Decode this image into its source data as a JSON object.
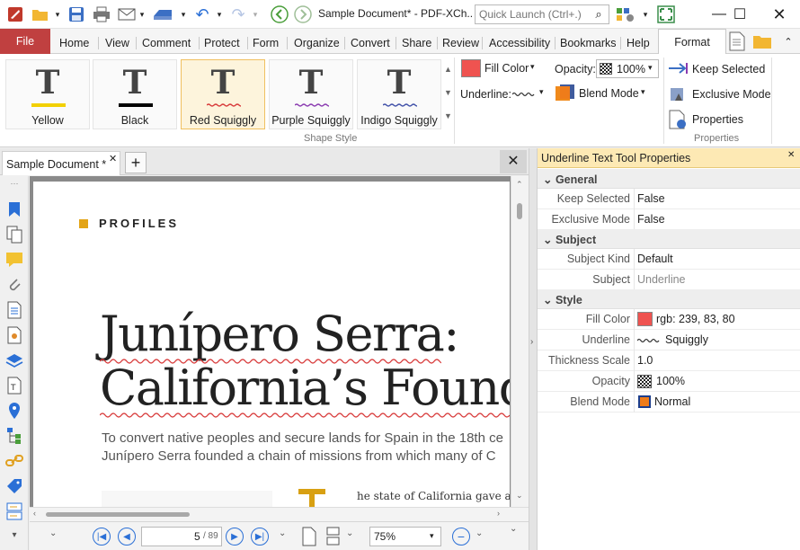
{
  "window": {
    "title": "Sample Document* - PDF-XCh..",
    "quick_launch_placeholder": "Quick Launch (Ctrl+.)"
  },
  "menu_tabs": [
    "File",
    "Home",
    "View",
    "Comment",
    "Protect",
    "Form",
    "Organize",
    "Convert",
    "Share",
    "Review",
    "Accessibility",
    "Bookmarks",
    "Help",
    "Format"
  ],
  "ribbon": {
    "shapes": [
      {
        "label": "Yellow",
        "color": "#f2d000",
        "style": "solid"
      },
      {
        "label": "Black",
        "color": "#000000",
        "style": "solid"
      },
      {
        "label": "Red Squiggly",
        "color": "#d83a3a",
        "style": "squiggly"
      },
      {
        "label": "Purple Squiggly",
        "color": "#8a3ab0",
        "style": "squiggly"
      },
      {
        "label": "Indigo Squiggly",
        "color": "#4050a8",
        "style": "squiggly"
      }
    ],
    "shape_style_label": "Shape Style",
    "fill_color_label": "Fill Color",
    "fill_color": "#ef5350",
    "underline_label": "Underline:",
    "opacity_label": "Opacity:",
    "opacity_value": "100%",
    "blend_mode_label": "Blend Mode",
    "keep_selected_label": "Keep Selected",
    "exclusive_mode_label": "Exclusive Mode",
    "properties_label": "Properties",
    "properties_group_label": "Properties"
  },
  "document": {
    "tab_label": "Sample Document *",
    "section_label": "PROFILES",
    "heading_line1": "Junípero Serra:",
    "heading_line2": "California’s Foundin",
    "body_line1": "To convert native peoples and secure lands for Spain in the 18th ce",
    "body_line2": "Junípero Serra founded a chain of missions from which many of C",
    "col_text": "he state of California gave a"
  },
  "statusbar": {
    "page_current": "5",
    "page_total": "/ 89",
    "zoom": "75%"
  },
  "properties_panel": {
    "title": "Underline Text Tool Properties",
    "categories": [
      {
        "name": "General",
        "rows": [
          {
            "name": "Keep Selected",
            "value": "False"
          },
          {
            "name": "Exclusive Mode",
            "value": "False"
          }
        ]
      },
      {
        "name": "Subject",
        "rows": [
          {
            "name": "Subject Kind",
            "value": "Default"
          },
          {
            "name": "Subject",
            "value": "Underline"
          }
        ]
      },
      {
        "name": "Style",
        "rows": [
          {
            "name": "Fill Color",
            "value": "rgb: 239, 83, 80"
          },
          {
            "name": "Underline",
            "value": "Squiggly"
          },
          {
            "name": "Thickness Scale",
            "value": "1.0"
          },
          {
            "name": "Opacity",
            "value": "100%"
          },
          {
            "name": "Blend Mode",
            "value": "Normal"
          }
        ]
      }
    ]
  },
  "colors": {
    "file_tab": "#c04040",
    "accent_blue": "#2a6fd6",
    "panel_header": "#fde9b4"
  }
}
